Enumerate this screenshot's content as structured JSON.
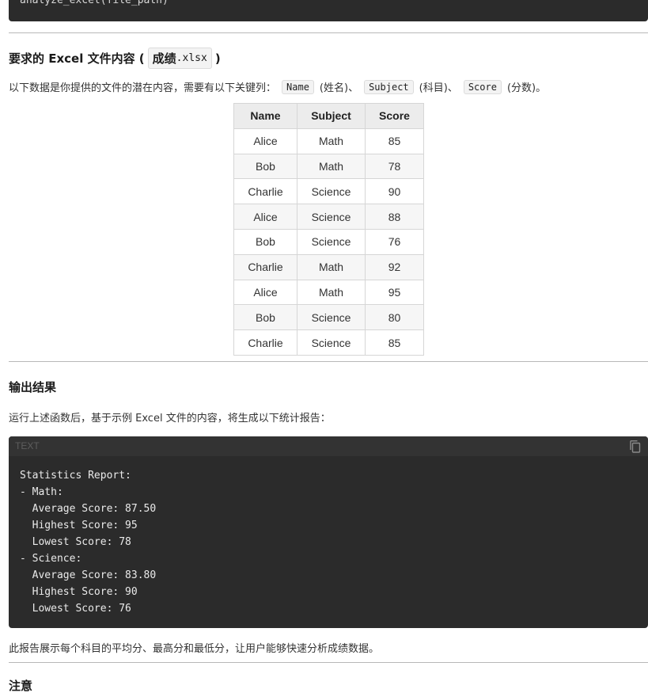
{
  "top_code": {
    "text": "analyze_excel(file_path)"
  },
  "section_excel": {
    "heading_prefix": "要求的 Excel 文件内容 (",
    "heading_chip_cn": "成绩",
    "heading_chip_code": ".xlsx",
    "heading_suffix": ")",
    "intro_prefix": "以下数据是你提供的文件的潜在内容，需要有以下关键列：",
    "key_name": "Name",
    "key_name_cn": "(姓名)、",
    "key_subject": "Subject",
    "key_subject_cn": "(科目)、",
    "key_score": "Score",
    "key_score_cn": "(分数)。"
  },
  "table": {
    "headers": [
      "Name",
      "Subject",
      "Score"
    ],
    "rows": [
      [
        "Alice",
        "Math",
        "85"
      ],
      [
        "Bob",
        "Math",
        "78"
      ],
      [
        "Charlie",
        "Science",
        "90"
      ],
      [
        "Alice",
        "Science",
        "88"
      ],
      [
        "Bob",
        "Science",
        "76"
      ],
      [
        "Charlie",
        "Math",
        "92"
      ],
      [
        "Alice",
        "Math",
        "95"
      ],
      [
        "Bob",
        "Science",
        "80"
      ],
      [
        "Charlie",
        "Science",
        "85"
      ]
    ]
  },
  "section_output": {
    "heading": "输出结果",
    "intro": "运行上述函数后，基于示例 Excel 文件的内容，将生成以下统计报告：",
    "code_lang": "TEXT",
    "code": "Statistics Report:\n- Math:\n  Average Score: 87.50\n  Highest Score: 95\n  Lowest Score: 78\n- Science:\n  Average Score: 83.80\n  Highest Score: 90\n  Lowest Score: 76",
    "summary": "此报告展示每个科目的平均分、最高分和最低分，让用户能够快速分析成绩数据。"
  },
  "section_note": {
    "heading": "注意"
  }
}
